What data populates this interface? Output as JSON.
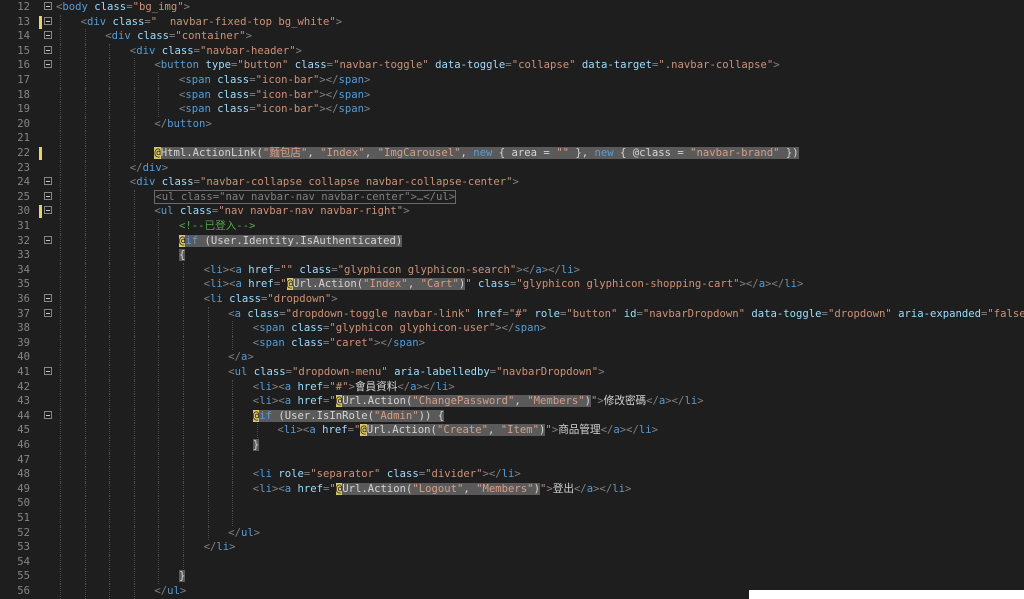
{
  "lines": [
    {
      "n": "12",
      "fold": true,
      "mark": false,
      "indent": 0,
      "html": "<span class='d'>&lt;</span><span class='t'>body</span> <span class='a'>class</span><span class='d'>=</span><span class='s'>\"bg_img\"</span><span class='d'>&gt;</span>"
    },
    {
      "n": "13",
      "fold": true,
      "mark": true,
      "indent": 1,
      "html": "<span class='d'>&lt;</span><span class='t'>div</span> <span class='a'>class</span><span class='d'>=</span><span class='s'>\"  navbar-fixed-top bg_white\"</span><span class='d'>&gt;</span>"
    },
    {
      "n": "14",
      "fold": true,
      "mark": false,
      "indent": 2,
      "html": "<span class='d'>&lt;</span><span class='t'>div</span> <span class='a'>class</span><span class='d'>=</span><span class='s'>\"container\"</span><span class='d'>&gt;</span>"
    },
    {
      "n": "15",
      "fold": true,
      "mark": false,
      "indent": 3,
      "html": "<span class='d'>&lt;</span><span class='t'>div</span> <span class='a'>class</span><span class='d'>=</span><span class='s'>\"navbar-header\"</span><span class='d'>&gt;</span>"
    },
    {
      "n": "16",
      "fold": true,
      "mark": false,
      "indent": 4,
      "html": "<span class='d'>&lt;</span><span class='t'>button</span> <span class='a'>type</span><span class='d'>=</span><span class='s'>\"button\"</span> <span class='a'>class</span><span class='d'>=</span><span class='s'>\"navbar-toggle\"</span> <span class='a'>data-toggle</span><span class='d'>=</span><span class='s'>\"collapse\"</span> <span class='a'>data-target</span><span class='d'>=</span><span class='s'>\".navbar-collapse\"</span><span class='d'>&gt;</span>"
    },
    {
      "n": "17",
      "fold": false,
      "mark": false,
      "indent": 5,
      "html": "<span class='d'>&lt;</span><span class='t'>span</span> <span class='a'>class</span><span class='d'>=</span><span class='s'>\"icon-bar\"</span><span class='d'>&gt;&lt;/</span><span class='t'>span</span><span class='d'>&gt;</span>"
    },
    {
      "n": "18",
      "fold": false,
      "mark": false,
      "indent": 5,
      "html": "<span class='d'>&lt;</span><span class='t'>span</span> <span class='a'>class</span><span class='d'>=</span><span class='s'>\"icon-bar\"</span><span class='d'>&gt;&lt;/</span><span class='t'>span</span><span class='d'>&gt;</span>"
    },
    {
      "n": "19",
      "fold": false,
      "mark": false,
      "indent": 5,
      "html": "<span class='d'>&lt;</span><span class='t'>span</span> <span class='a'>class</span><span class='d'>=</span><span class='s'>\"icon-bar\"</span><span class='d'>&gt;&lt;/</span><span class='t'>span</span><span class='d'>&gt;</span>"
    },
    {
      "n": "20",
      "fold": false,
      "mark": false,
      "indent": 4,
      "html": "<span class='d'>&lt;/</span><span class='t'>button</span><span class='d'>&gt;</span>"
    },
    {
      "n": "21",
      "fold": false,
      "mark": false,
      "indent": 4,
      "html": ""
    },
    {
      "n": "22",
      "fold": false,
      "mark": true,
      "indent": 4,
      "html": "<span class='razor'><span class='at'>@</span>Html.ActionLink(<span class='str'>\"麵包店\"</span>, <span class='str'>\"Index\"</span>, <span class='str'>\"ImgCarousel\"</span>, <span class='k'>new</span> { area = <span class='str'>\"\"</span> }, <span class='k'>new</span> { @class = <span class='str'>\"navbar-brand\"</span> })</span>"
    },
    {
      "n": "23",
      "fold": false,
      "mark": false,
      "indent": 3,
      "html": "<span class='d'>&lt;/</span><span class='t'>div</span><span class='d'>&gt;</span>"
    },
    {
      "n": "24",
      "fold": true,
      "mark": false,
      "indent": 3,
      "html": "<span class='d'>&lt;</span><span class='t'>div</span> <span class='a'>class</span><span class='d'>=</span><span class='s'>\"navbar-collapse collapse navbar-collapse-center\"</span><span class='d'>&gt;</span>"
    },
    {
      "n": "25",
      "fold": true,
      "mark": false,
      "indent": 4,
      "html": "<span class='collapsed'>&lt;ul class=\"nav navbar-nav navbar-center\"&gt;…&lt;/ul&gt;</span>"
    },
    {
      "n": "30",
      "fold": true,
      "mark": true,
      "indent": 4,
      "html": "<span class='d'>&lt;</span><span class='t'>ul</span> <span class='a'>class</span><span class='d'>=</span><span class='s'>\"nav navbar-nav navbar-right\"</span><span class='d'>&gt;</span>"
    },
    {
      "n": "31",
      "fold": false,
      "mark": false,
      "indent": 5,
      "html": "<span class='cm'>&lt;!--已登入--&gt;</span>"
    },
    {
      "n": "32",
      "fold": true,
      "mark": false,
      "indent": 5,
      "html": "<span class='razor'><span class='at'>@</span><span class='k'>if</span> (User.Identity.IsAuthenticated)</span>"
    },
    {
      "n": "33",
      "fold": false,
      "mark": false,
      "indent": 5,
      "html": "<span class='razor'>{</span>"
    },
    {
      "n": "34",
      "fold": false,
      "mark": false,
      "indent": 6,
      "html": "<span class='d'>&lt;</span><span class='t'>li</span><span class='d'>&gt;&lt;</span><span class='t'>a</span> <span class='a'>href</span><span class='d'>=</span><span class='s'>\"\"</span> <span class='a'>class</span><span class='d'>=</span><span class='s'>\"glyphicon glyphicon-search\"</span><span class='d'>&gt;&lt;/</span><span class='t'>a</span><span class='d'>&gt;&lt;/</span><span class='t'>li</span><span class='d'>&gt;</span>"
    },
    {
      "n": "35",
      "fold": false,
      "mark": false,
      "indent": 6,
      "html": "<span class='d'>&lt;</span><span class='t'>li</span><span class='d'>&gt;&lt;</span><span class='t'>a</span> <span class='a'>href</span><span class='d'>=</span><span class='s'>\"</span><span class='razor'><span class='at'>@</span>Url.Action(<span class='str'>\"Index\"</span>, <span class='str'>\"Cart\"</span>)</span><span class='s'>\"</span> <span class='a'>class</span><span class='d'>=</span><span class='s'>\"glyphicon glyphicon-shopping-cart\"</span><span class='d'>&gt;&lt;/</span><span class='t'>a</span><span class='d'>&gt;&lt;/</span><span class='t'>li</span><span class='d'>&gt;</span>"
    },
    {
      "n": "36",
      "fold": true,
      "mark": false,
      "indent": 6,
      "html": "<span class='d'>&lt;</span><span class='t'>li</span> <span class='a'>class</span><span class='d'>=</span><span class='s'>\"dropdown\"</span><span class='d'>&gt;</span>"
    },
    {
      "n": "37",
      "fold": true,
      "mark": false,
      "indent": 7,
      "html": "<span class='d'>&lt;</span><span class='t'>a</span> <span class='a'>class</span><span class='d'>=</span><span class='s'>\"dropdown-toggle navbar-link\"</span> <span class='a'>href</span><span class='d'>=</span><span class='s'>\"#\"</span> <span class='a'>role</span><span class='d'>=</span><span class='s'>\"button\"</span> <span class='a'>id</span><span class='d'>=</span><span class='s'>\"navbarDropdown\"</span> <span class='a'>data-toggle</span><span class='d'>=</span><span class='s'>\"dropdown\"</span> <span class='a'>aria-expanded</span><span class='d'>=</span><span class='s'>\"false\"</span><span class='d'>&gt;</span>"
    },
    {
      "n": "38",
      "fold": false,
      "mark": false,
      "indent": 8,
      "html": "<span class='d'>&lt;</span><span class='t'>span</span> <span class='a'>class</span><span class='d'>=</span><span class='s'>\"glyphicon glyphicon-user\"</span><span class='d'>&gt;&lt;/</span><span class='t'>span</span><span class='d'>&gt;</span>"
    },
    {
      "n": "39",
      "fold": false,
      "mark": false,
      "indent": 8,
      "html": "<span class='d'>&lt;</span><span class='t'>span</span> <span class='a'>class</span><span class='d'>=</span><span class='s'>\"caret\"</span><span class='d'>&gt;&lt;/</span><span class='t'>span</span><span class='d'>&gt;</span>"
    },
    {
      "n": "40",
      "fold": false,
      "mark": false,
      "indent": 7,
      "html": "<span class='d'>&lt;/</span><span class='t'>a</span><span class='d'>&gt;</span>"
    },
    {
      "n": "41",
      "fold": true,
      "mark": false,
      "indent": 7,
      "html": "<span class='d'>&lt;</span><span class='t'>ul</span> <span class='a'>class</span><span class='d'>=</span><span class='s'>\"dropdown-menu\"</span> <span class='a'>aria-labelledby</span><span class='d'>=</span><span class='s'>\"navbarDropdown\"</span><span class='d'>&gt;</span>"
    },
    {
      "n": "42",
      "fold": false,
      "mark": false,
      "indent": 8,
      "html": "<span class='d'>&lt;</span><span class='t'>li</span><span class='d'>&gt;&lt;</span><span class='t'>a</span> <span class='a'>href</span><span class='d'>=</span><span class='s'>\"#\"</span><span class='d'>&gt;</span><span class='txt'>會員資料</span><span class='d'>&lt;/</span><span class='t'>a</span><span class='d'>&gt;&lt;/</span><span class='t'>li</span><span class='d'>&gt;</span>"
    },
    {
      "n": "43",
      "fold": false,
      "mark": false,
      "indent": 8,
      "html": "<span class='d'>&lt;</span><span class='t'>li</span><span class='d'>&gt;&lt;</span><span class='t'>a</span> <span class='a'>href</span><span class='d'>=</span><span class='s'>\"</span><span class='razor'><span class='at'>@</span>Url.Action(<span class='str'>\"ChangePassword\"</span>, <span class='str'>\"Members\"</span>)</span><span class='s'>\"</span><span class='d'>&gt;</span><span class='txt'>修改密碼</span><span class='d'>&lt;/</span><span class='t'>a</span><span class='d'>&gt;&lt;/</span><span class='t'>li</span><span class='d'>&gt;</span>"
    },
    {
      "n": "44",
      "fold": true,
      "mark": false,
      "indent": 8,
      "html": "<span class='razor'><span class='at'>@</span><span class='k'>if</span> (User.IsInRole(<span class='str'>\"Admin\"</span>)) {</span>"
    },
    {
      "n": "45",
      "fold": false,
      "mark": false,
      "indent": 9,
      "html": "<span class='d'>&lt;</span><span class='t'>li</span><span class='d'>&gt;&lt;</span><span class='t'>a</span> <span class='a'>href</span><span class='d'>=</span><span class='s'>\"</span><span class='razor'><span class='at'>@</span>Url.Action(<span class='str'>\"Create\"</span>, <span class='str'>\"Item\"</span>)</span><span class='s'>\"</span><span class='d'>&gt;</span><span class='txt'>商品管理</span><span class='d'>&lt;/</span><span class='t'>a</span><span class='d'>&gt;&lt;/</span><span class='t'>li</span><span class='d'>&gt;</span>"
    },
    {
      "n": "46",
      "fold": false,
      "mark": false,
      "indent": 8,
      "html": "<span class='razor'>}</span>"
    },
    {
      "n": "47",
      "fold": false,
      "mark": false,
      "indent": 8,
      "html": ""
    },
    {
      "n": "48",
      "fold": false,
      "mark": false,
      "indent": 8,
      "html": "<span class='d'>&lt;</span><span class='t'>li</span> <span class='a'>role</span><span class='d'>=</span><span class='s'>\"separator\"</span> <span class='a'>class</span><span class='d'>=</span><span class='s'>\"divider\"</span><span class='d'>&gt;&lt;/</span><span class='t'>li</span><span class='d'>&gt;</span>"
    },
    {
      "n": "49",
      "fold": false,
      "mark": false,
      "indent": 8,
      "html": "<span class='d'>&lt;</span><span class='t'>li</span><span class='d'>&gt;&lt;</span><span class='t'>a</span> <span class='a'>href</span><span class='d'>=</span><span class='s'>\"</span><span class='razor'><span class='at'>@</span>Url.Action(<span class='str'>\"Logout\"</span>, <span class='str'>\"Members\"</span>)</span><span class='s'>\"</span><span class='d'>&gt;</span><span class='txt'>登出</span><span class='d'>&lt;/</span><span class='t'>a</span><span class='d'>&gt;&lt;/</span><span class='t'>li</span><span class='d'>&gt;</span>"
    },
    {
      "n": "50",
      "fold": false,
      "mark": false,
      "indent": 8,
      "html": ""
    },
    {
      "n": "51",
      "fold": false,
      "mark": false,
      "indent": 8,
      "html": ""
    },
    {
      "n": "52",
      "fold": false,
      "mark": false,
      "indent": 7,
      "html": "<span class='d'>&lt;/</span><span class='t'>ul</span><span class='d'>&gt;</span>"
    },
    {
      "n": "53",
      "fold": false,
      "mark": false,
      "indent": 6,
      "html": "<span class='d'>&lt;/</span><span class='t'>li</span><span class='d'>&gt;</span>"
    },
    {
      "n": "54",
      "fold": false,
      "mark": false,
      "indent": 6,
      "html": ""
    },
    {
      "n": "55",
      "fold": false,
      "mark": false,
      "indent": 5,
      "html": "<span class='razor'>}</span>"
    },
    {
      "n": "56",
      "fold": false,
      "mark": false,
      "indent": 4,
      "html": "<span class='d'>&lt;/</span><span class='t'>ul</span><span class='d'>&gt;</span>"
    }
  ],
  "colors": {
    "background": "#1e1e1e",
    "tag": "#569cd6",
    "attribute": "#9cdcfe",
    "string": "#ce9178",
    "comment": "#57a64a",
    "razor_bg": "#5a5a5a",
    "razor_at": "#d7c66b",
    "modified_marker": "#e6d36b"
  }
}
